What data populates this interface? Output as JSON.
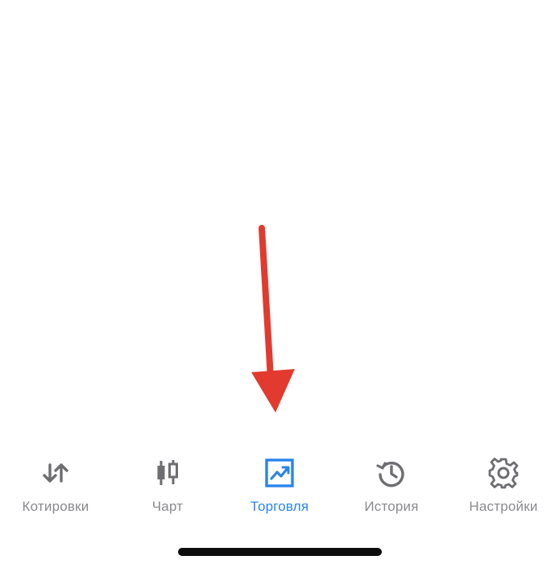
{
  "colors": {
    "inactive": "#8a8a8e",
    "active": "#2b84ec",
    "annotation": "#e23a2e",
    "home_indicator": "#0c0c0c"
  },
  "tabs": [
    {
      "id": "quotes",
      "label": "Котировки",
      "icon": "arrows-up-down-icon",
      "active": false
    },
    {
      "id": "chart",
      "label": "Чарт",
      "icon": "candlestick-icon",
      "active": false
    },
    {
      "id": "trade",
      "label": "Торговля",
      "icon": "trade-chart-icon",
      "active": true
    },
    {
      "id": "history",
      "label": "История",
      "icon": "history-clock-icon",
      "active": false
    },
    {
      "id": "settings",
      "label": "Настройки",
      "icon": "gear-icon",
      "active": false
    }
  ]
}
